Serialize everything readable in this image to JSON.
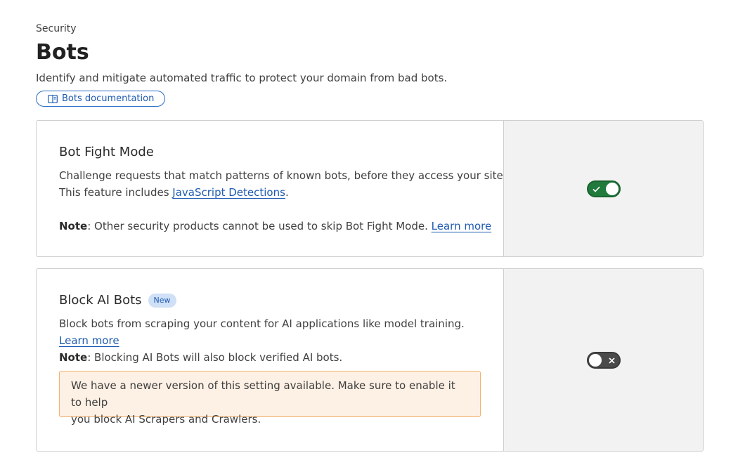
{
  "header": {
    "eyebrow": "Security",
    "title": "Bots",
    "subtitle": "Identify and mitigate automated traffic to protect your domain from bad bots.",
    "doc_link_label": "Bots documentation",
    "doc_link_icon": "book-icon"
  },
  "bot_fight_mode": {
    "title": "Bot Fight Mode",
    "description_line1": "Challenge requests that match patterns of known bots, before they access your site.",
    "description_line2_prefix": "This feature includes ",
    "description_line2_link": "JavaScript Detections",
    "description_line2_suffix": ".",
    "note_label": "Note",
    "note_text": ": Other security products cannot be used to skip Bot Fight Mode. ",
    "learn_more": "Learn more",
    "toggle_state": "on",
    "toggle_icon": "check-icon",
    "toggle_color": "#1f7a3c"
  },
  "block_ai_bots": {
    "title": "Block AI Bots",
    "badge": "New",
    "description": "Block bots from scraping your content for AI applications like model training.",
    "learn_more": "Learn more",
    "note_label": "Note",
    "note_text": ": Blocking AI Bots will also block verified AI bots.",
    "notice_line1": "We have a newer version of this setting available. Make sure to enable it to help",
    "notice_line2": "you block AI Scrapers and Crawlers.",
    "toggle_state": "off",
    "toggle_icon": "close-icon",
    "toggle_color": "#4a4a4a",
    "notice_background": "#fdf0e4",
    "notice_border": "#f2b36d"
  }
}
